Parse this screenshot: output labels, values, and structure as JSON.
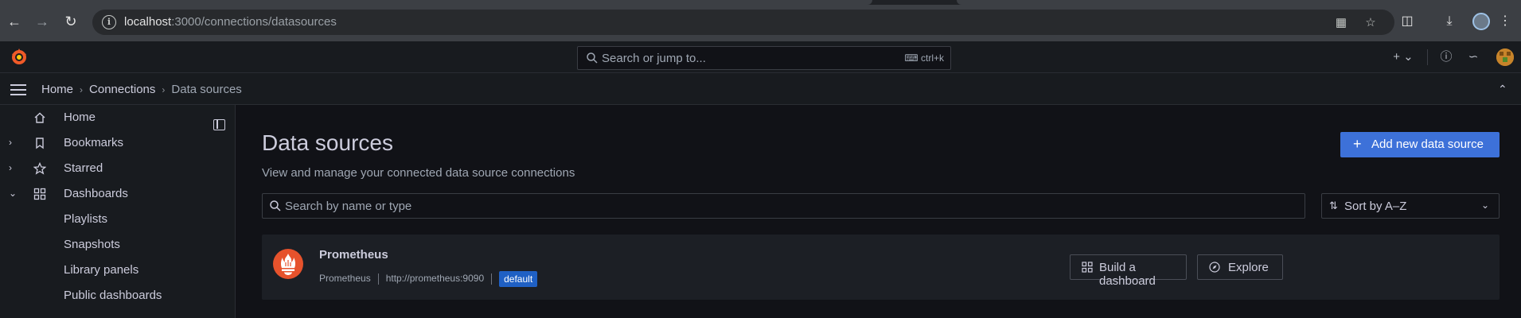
{
  "browser": {
    "url_host": "localhost",
    "url_path": ":3000/connections/datasources"
  },
  "topbar": {
    "search_placeholder": "Search or jump to...",
    "search_shortcut": "ctrl+k",
    "new_label": "+"
  },
  "breadcrumb": {
    "items": [
      "Home",
      "Connections",
      "Data sources"
    ]
  },
  "sidebar": {
    "items": [
      {
        "label": "Home",
        "icon": "home-icon"
      },
      {
        "label": "Bookmarks",
        "icon": "bookmark-icon"
      },
      {
        "label": "Starred",
        "icon": "star-icon"
      },
      {
        "label": "Dashboards",
        "icon": "apps-icon"
      },
      {
        "label": "Playlists"
      },
      {
        "label": "Snapshots"
      },
      {
        "label": "Library panels"
      },
      {
        "label": "Public dashboards"
      }
    ]
  },
  "page": {
    "title": "Data sources",
    "subtitle": "View and manage your connected data source connections",
    "add_button": "Add new data source",
    "search_placeholder": "Search by name or type",
    "sort_label": "Sort by A–Z"
  },
  "datasource": {
    "name": "Prometheus",
    "type": "Prometheus",
    "url": "http://prometheus:9090",
    "badge": "default",
    "build_button": "Build a dashboard",
    "explore_button": "Explore"
  },
  "colors": {
    "accent": "#3d71d9",
    "prometheus": "#e6522c",
    "badge": "#1f60c4"
  }
}
